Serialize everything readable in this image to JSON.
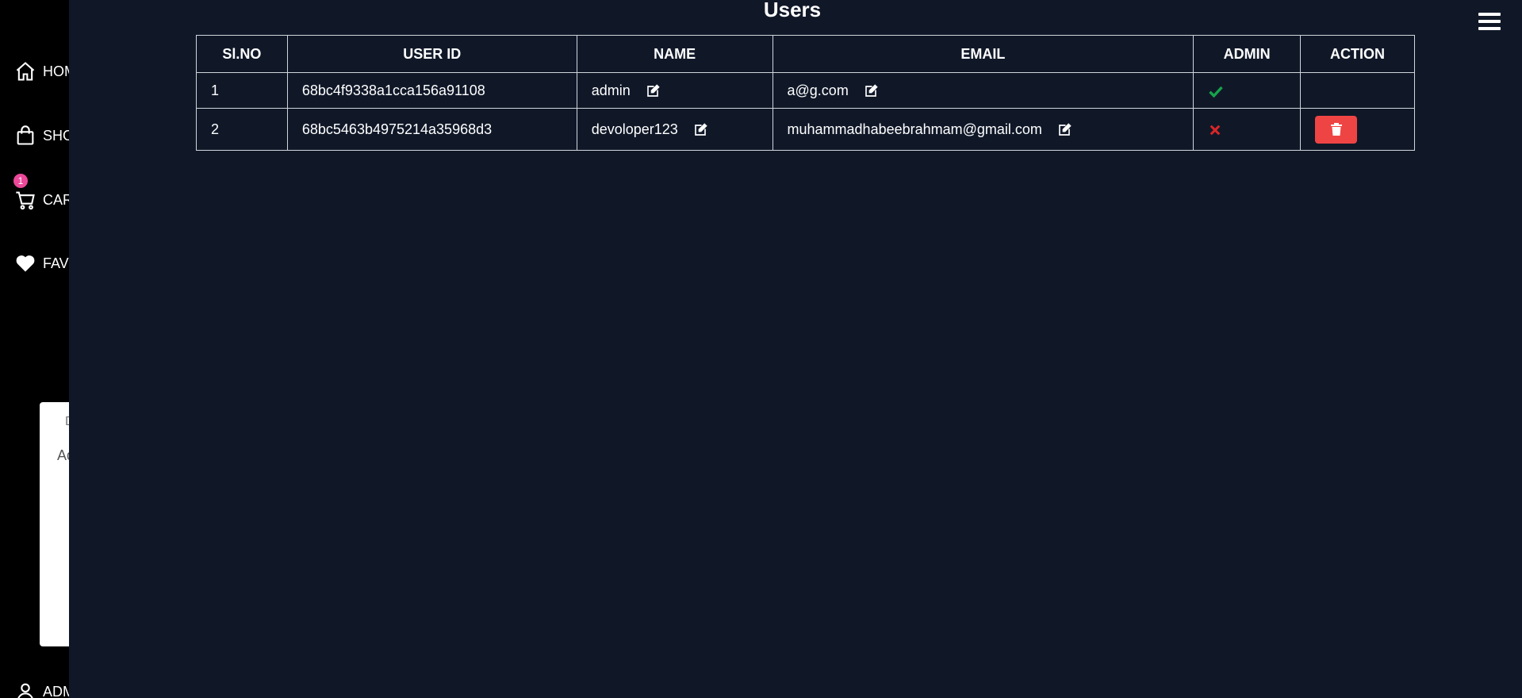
{
  "sidebar": {
    "items": [
      {
        "label": "HOME",
        "icon": "home-icon"
      },
      {
        "label": "SHOP",
        "icon": "shopping-bag-icon"
      },
      {
        "label": "CART",
        "icon": "cart-icon"
      },
      {
        "label": "FAVORITES",
        "icon": "heart-icon"
      }
    ],
    "cart_count": "1",
    "user_label": "ADMIN",
    "dropdown": {
      "line1": "D",
      "line2": "Ad"
    }
  },
  "page": {
    "title": "Users"
  },
  "table": {
    "headers": [
      "Sl.NO",
      "USER ID",
      "NAME",
      "EMAIL",
      "ADMIN",
      "ACTION"
    ],
    "rows": [
      {
        "slno": "1",
        "user_id": "68bc4f9338a1cca156a91108",
        "name": "admin",
        "email": "a@g.com",
        "is_admin": true
      },
      {
        "slno": "2",
        "user_id": "68bc5463b4975214a35968d3",
        "name": "devoloper123",
        "email": "muhammadhabeebrahmam@gmail.com",
        "is_admin": false
      }
    ]
  },
  "colors": {
    "background": "#101828",
    "sidebar": "#000000",
    "badge": "#ec4899",
    "admin_true": "#16a34a",
    "admin_false": "#dc2626",
    "delete_button": "#ef4444"
  }
}
